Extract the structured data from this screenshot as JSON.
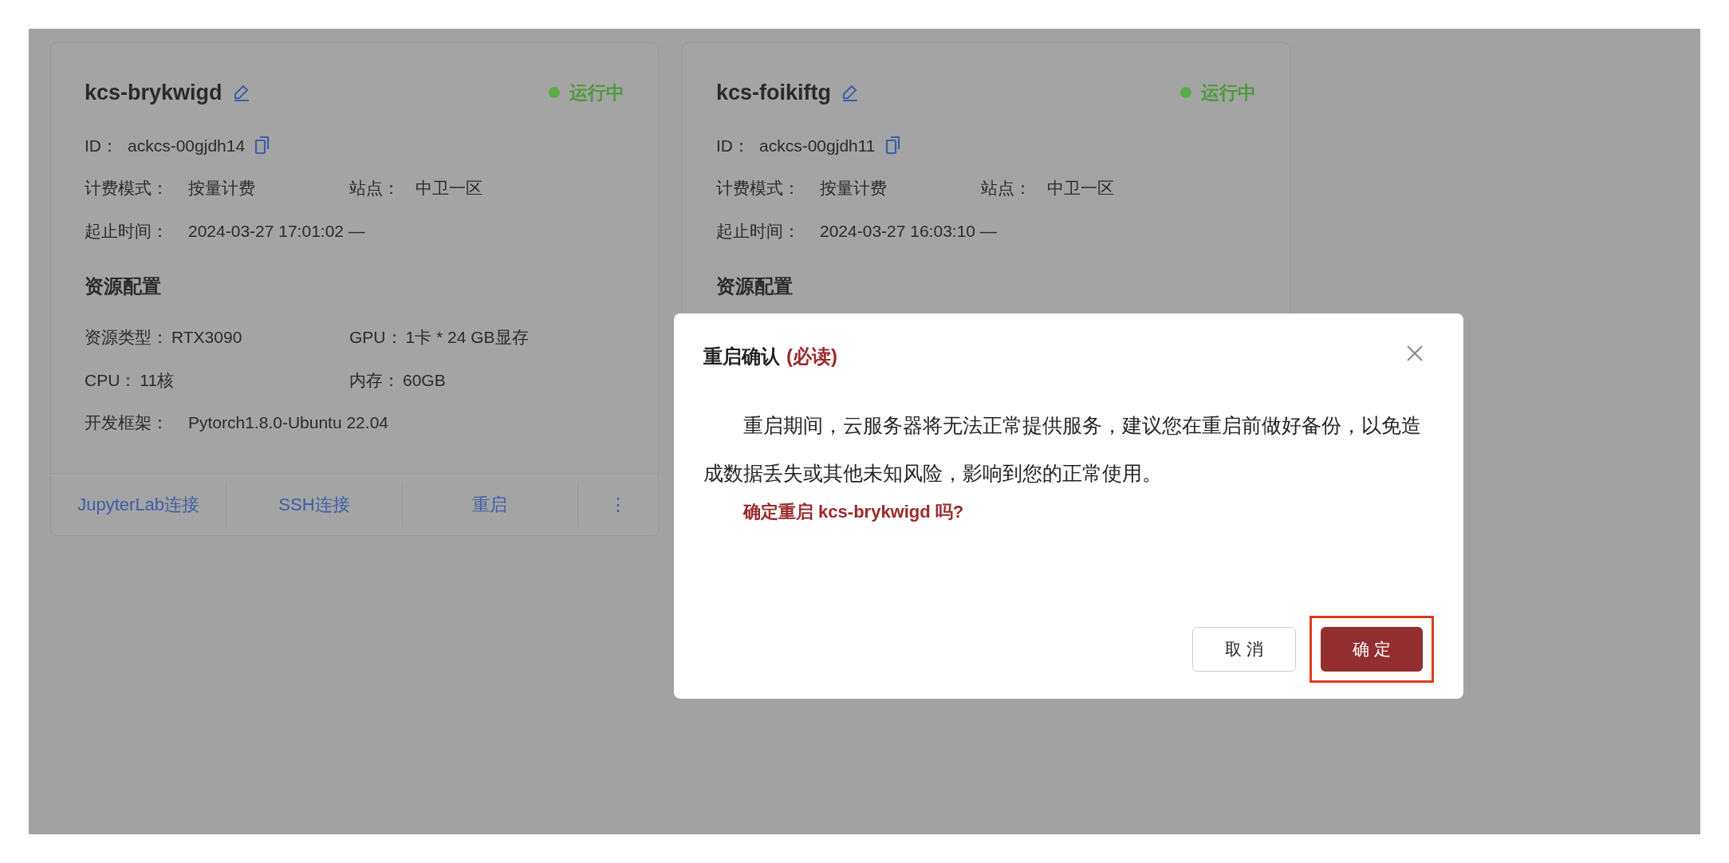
{
  "instances": [
    {
      "name": "kcs-brykwigd",
      "status": "运行中",
      "color": "#5aad46",
      "id_label": "ID：",
      "id": "ackcs-00gjdh14",
      "billing_label": "计费模式：",
      "billing": "按量计费",
      "site_label": "站点：",
      "site": "中卫一区",
      "time_label": "起止时间：",
      "time": "2024-03-27 17:01:02 —",
      "resources_heading": "资源配置",
      "resources": [
        {
          "label": "资源类型：",
          "value": "RTX3090"
        },
        {
          "label": "GPU：",
          "value": "1卡 * 24 GB显存"
        },
        {
          "label": "CPU：",
          "value": "11核"
        },
        {
          "label": "内存：",
          "value": "60GB"
        }
      ],
      "framework_label": "开发框架：",
      "framework": "Pytorch1.8.0-Ubuntu 22.04",
      "actions": [
        "JupyterLab连接",
        "SSH连接",
        "重启",
        "⋮"
      ]
    },
    {
      "name": "kcs-foikiftg",
      "status": "运行中",
      "color": "#5aad46",
      "id_label": "ID：",
      "id": "ackcs-00gjdh11",
      "billing_label": "计费模式：",
      "billing": "按量计费",
      "site_label": "站点：",
      "site": "中卫一区",
      "time_label": "起止时间：",
      "time": "2024-03-27 16:03:10 —",
      "resources_heading": "资源配置"
    }
  ],
  "dialog": {
    "title": "重启确认",
    "title_note": "(必读)",
    "message": "重启期间，云服务器将无法正常提供服务，建议您在重启前做好备份，以免造成数据丢失或其他未知风险，影响到您的正常使用。",
    "question": "确定重启 kcs-brykwigd 吗?",
    "buttons": [
      {
        "label": "取 消",
        "kind": "secondary"
      },
      {
        "label": "确 定",
        "kind": "primary"
      }
    ]
  }
}
